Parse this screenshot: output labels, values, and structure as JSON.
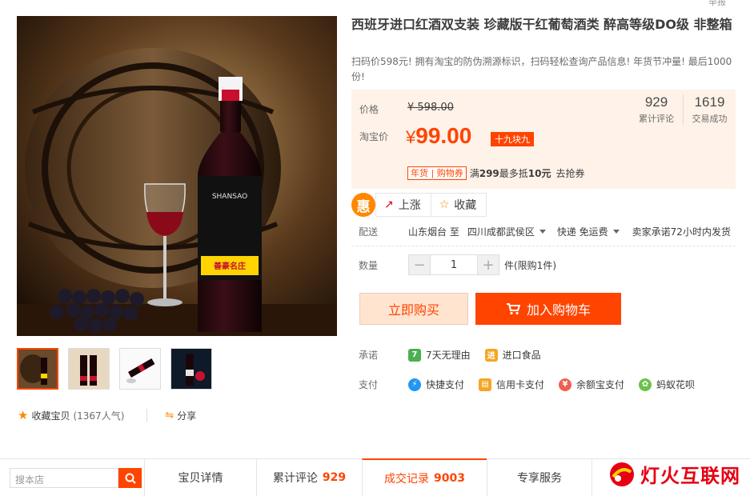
{
  "top": {
    "report_label": "举报"
  },
  "product": {
    "title": "西班牙进口红酒双支装 珍藏版干红葡萄酒类 醉高等级DO级 非整箱",
    "subtitle": "扫码价598元! 拥有淘宝的防伪溯源标识，扫码轻松查询产品信息! 年货节冲量! 最后1000份!"
  },
  "price": {
    "orig_label": "价格",
    "orig_value": "¥ 598.00",
    "promo_label": "淘宝价",
    "promo_currency": "¥",
    "promo_value": "99.00",
    "promo_tag": "十九块九",
    "reviews_count": "929",
    "reviews_label": "累计评论",
    "sales_count": "1619",
    "sales_label": "交易成功"
  },
  "coupon": {
    "badge": "年货 | 购物券",
    "text_prefix": "满",
    "threshold": "299",
    "text_mid": "最多抵",
    "discount": "10元",
    "link": "去抢券"
  },
  "social": {
    "logo": "惠",
    "rise_label": "上涨",
    "fav_label": "收藏"
  },
  "delivery": {
    "label": "配送",
    "from": "山东烟台 至",
    "to": "四川成都武侯区",
    "shipping": "快递 免运费",
    "promise": "卖家承诺72小时内发货"
  },
  "quantity": {
    "label": "数量",
    "value": "1",
    "minus": "−",
    "plus": "+",
    "limit": "件(限购1件)"
  },
  "actions": {
    "buy_now": "立即购买",
    "add_cart": "加入购物车"
  },
  "promise": {
    "label": "承诺",
    "items": [
      {
        "icon": "7",
        "text": "7天无理由",
        "color": "#4caf50"
      },
      {
        "icon": "进",
        "text": "进口食品",
        "color": "#f5a623"
      }
    ]
  },
  "payment": {
    "label": "支付",
    "items": [
      {
        "icon": "⚡",
        "text": "快捷支付",
        "color": "#2196f3"
      },
      {
        "icon": "▤",
        "text": "信用卡支付",
        "color": "#f5a623"
      },
      {
        "icon": "¥",
        "text": "余额宝支付",
        "color": "#f06050"
      },
      {
        "icon": "✿",
        "text": "蚂蚁花呗",
        "color": "#6cc24a"
      }
    ]
  },
  "gallery": {
    "fav_label": "收藏宝贝",
    "fav_count": "(1367人气)",
    "share_label": "分享"
  },
  "tabs": {
    "search_placeholder": "搜本店",
    "items": [
      {
        "label": "宝贝详情",
        "count": ""
      },
      {
        "label": "累计评论",
        "count": "929"
      },
      {
        "label": "成交记录",
        "count": "9003"
      },
      {
        "label": "专享服务",
        "count": ""
      }
    ]
  },
  "watermark": {
    "text": "灯火互联网"
  },
  "colors": {
    "accent": "#ff4400",
    "price_bg": "#fff2e8"
  }
}
